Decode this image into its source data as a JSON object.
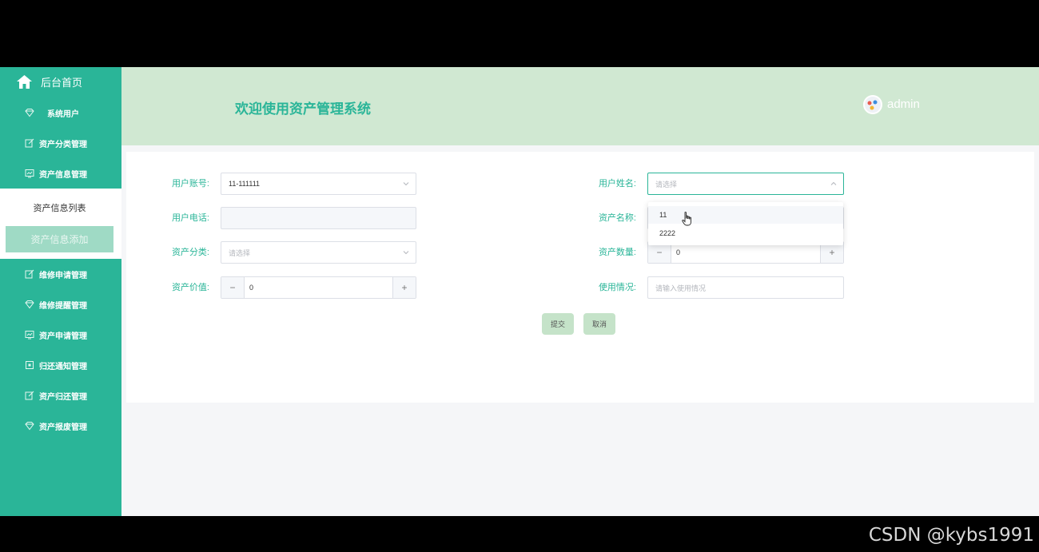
{
  "sidebar": {
    "home_label": "后台首页",
    "items": [
      {
        "label": "系统用户",
        "icon": "diamond-icon"
      },
      {
        "label": "资产分类管理",
        "icon": "edit-icon"
      },
      {
        "label": "资产信息管理",
        "icon": "monitor-icon"
      },
      {
        "label": "维修申请管理",
        "icon": "edit-icon"
      },
      {
        "label": "维修提醒管理",
        "icon": "diamond-icon"
      },
      {
        "label": "资产申请管理",
        "icon": "monitor-icon"
      },
      {
        "label": "归还通知管理",
        "icon": "square-icon"
      },
      {
        "label": "资产归还管理",
        "icon": "edit-icon"
      },
      {
        "label": "资产报废管理",
        "icon": "diamond-icon"
      }
    ],
    "submenu": {
      "list_label": "资产信息列表",
      "add_label": "资产信息添加"
    }
  },
  "header": {
    "title": "欢迎使用资产管理系统",
    "username": "admin"
  },
  "form": {
    "account_label": "用户账号:",
    "account_value": "11-111111",
    "name_label": "用户姓名:",
    "name_placeholder": "请选择",
    "phone_label": "用户电话:",
    "phone_value": "",
    "asset_name_label": "资产名称:",
    "category_label": "资产分类:",
    "category_placeholder": "请选择",
    "quantity_label": "资产数量:",
    "quantity_value": "0",
    "price_label": "资产价值:",
    "price_value": "0",
    "usage_label": "使用情况:",
    "usage_placeholder": "请输入使用情况",
    "submit_label": "提交",
    "cancel_label": "取消"
  },
  "dropdown": {
    "options": [
      "11",
      "2222"
    ]
  },
  "watermark": "CSDN @kybs1991",
  "colors": {
    "sidebar": "#2ab598",
    "header": "#d0e8d2",
    "accent": "#2ab598"
  }
}
